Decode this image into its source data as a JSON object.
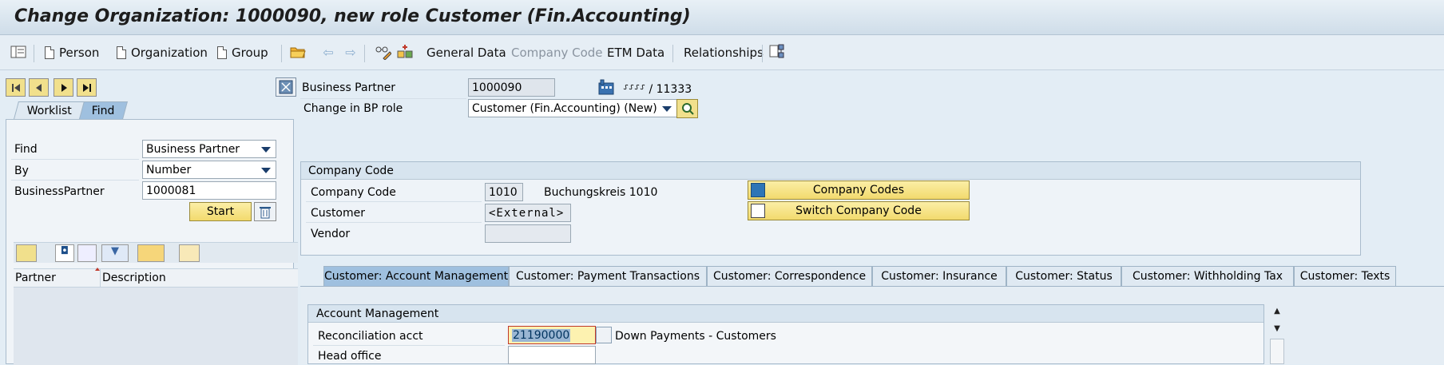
{
  "window": {
    "title": "Change Organization: 1000090, new role Customer (Fin.Accounting)"
  },
  "toolbar": {
    "person": "Person",
    "organization": "Organization",
    "group": "Group",
    "general_data": "General Data",
    "company_code": "Company Code",
    "etm_data": "ETM Data",
    "relationships": "Relationships"
  },
  "left": {
    "tabs": {
      "worklist": "Worklist",
      "find": "Find"
    },
    "find_label": "Find",
    "find_value": "Business Partner",
    "by_label": "By",
    "by_value": "Number",
    "bp_label": "BusinessPartner",
    "bp_value": "1000081",
    "start": "Start",
    "columns": {
      "partner": "Partner",
      "description": "Description"
    }
  },
  "header": {
    "bp_label": "Business Partner",
    "bp_value": "1000090",
    "bp_address": "⸉⸉⸉⸉ / 11333",
    "role_label": "Change in BP role",
    "role_value": "Customer (Fin.Accounting) (New)"
  },
  "company_code_group": {
    "title": "Company Code",
    "cc_label": "Company Code",
    "cc_value": "1010",
    "cc_desc": "Buchungskreis 1010",
    "customer_label": "Customer",
    "customer_value": "<External>",
    "vendor_label": "Vendor",
    "vendor_value": "",
    "btn_company_codes": "Company Codes",
    "btn_switch": "Switch Company Code"
  },
  "tabs": [
    "Customer: Account Management",
    "Customer: Payment Transactions",
    "Customer: Correspondence",
    "Customer: Insurance",
    "Customer: Status",
    "Customer: Withholding Tax",
    "Customer: Texts"
  ],
  "account_mgmt": {
    "title": "Account Management",
    "recon_label": "Reconciliation acct",
    "recon_value": "21190000",
    "recon_desc": "Down Payments - Customers",
    "head_office_label": "Head office",
    "head_office_value": ""
  },
  "colors": {
    "accent_yellow": "#f2da6d",
    "active_tab": "#9fc0df"
  }
}
